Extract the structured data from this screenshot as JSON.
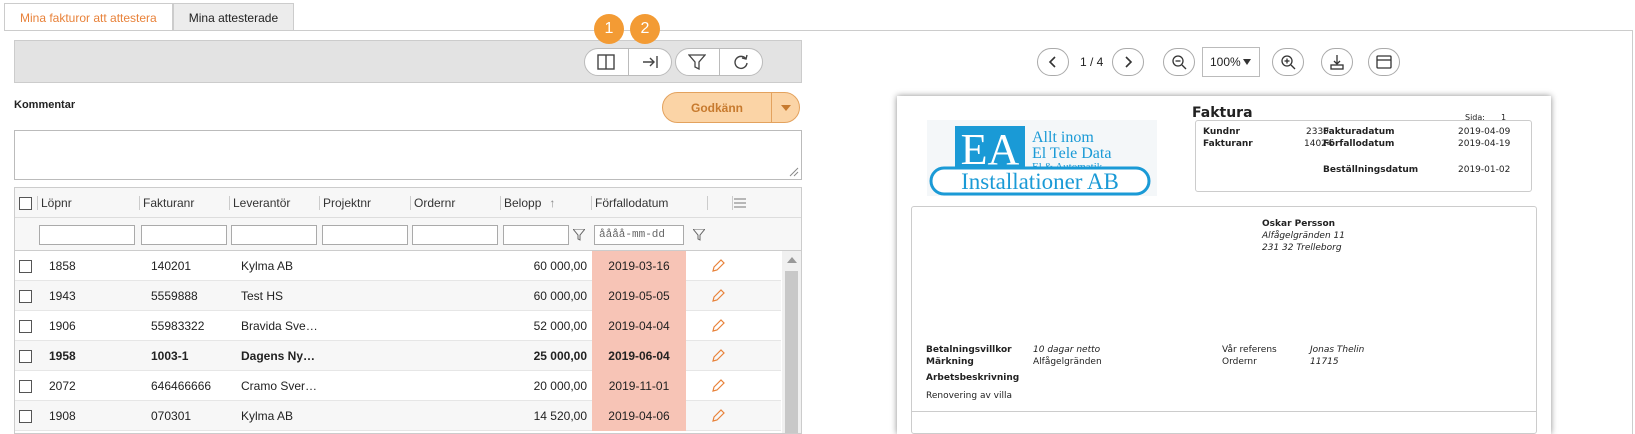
{
  "tabs": [
    {
      "label": "Mina fakturor att attestera"
    },
    {
      "label": "Mina attesterade"
    }
  ],
  "badges": [
    "1",
    "2"
  ],
  "comment_label": "Kommentar",
  "approve_label": "Godkänn",
  "grid": {
    "columns": [
      "Löpnr",
      "Fakturanr",
      "Leverantör",
      "Projektnr",
      "Ordernr",
      "Belopp",
      "Förfallodatum"
    ],
    "date_placeholder": "åååå-mm-dd",
    "sort_arrow": "↑",
    "rows": [
      {
        "lopnr": "1858",
        "fakturanr": "140201",
        "leverantor": "Kylma AB",
        "belopp": "60 000,00",
        "due": "2019-03-16",
        "bold": false
      },
      {
        "lopnr": "1943",
        "fakturanr": "5559888",
        "leverantor": "Test HS",
        "belopp": "60 000,00",
        "due": "2019-05-05",
        "bold": false
      },
      {
        "lopnr": "1906",
        "fakturanr": "55983322",
        "leverantor": "Bravida Sve…",
        "belopp": "52 000,00",
        "due": "2019-04-04",
        "bold": false
      },
      {
        "lopnr": "1958",
        "fakturanr": "1003-1",
        "leverantor": "Dagens Ny…",
        "belopp": "25 000,00",
        "due": "2019-06-04",
        "bold": true
      },
      {
        "lopnr": "2072",
        "fakturanr": "646466666",
        "leverantor": "Cramo Sver…",
        "belopp": "20 000,00",
        "due": "2019-11-01",
        "bold": false
      },
      {
        "lopnr": "1908",
        "fakturanr": "070301",
        "leverantor": "Kylma AB",
        "belopp": "14 520,00",
        "due": "2019-04-06",
        "bold": false
      }
    ]
  },
  "viewer": {
    "page": "1 / 4",
    "zoom": "100%"
  },
  "invoice": {
    "logo": {
      "letters": "EA",
      "line1": "Allt inom",
      "line2": "El Tele Data",
      "line3": "El & Automatik",
      "bottom": "Installationer AB"
    },
    "title": "Faktura",
    "sida_label": "Sida:",
    "sida_value": "1",
    "kundnr_label": "Kundnr",
    "kundnr": "2330",
    "fakturanr_label": "Fakturanr",
    "fakturanr": "14024",
    "fakturadatum_label": "Fakturadatum",
    "fakturadatum": "2019-04-09",
    "forfallodatum_label": "Förfallodatum",
    "forfallodatum": "2019-04-19",
    "bestallningsdatum_label": "Beställningsdatum",
    "bestallningsdatum": "2019-01-02",
    "recipient_name": "Oskar Persson",
    "recipient_street": "Alfågelgränden 11",
    "recipient_city": "231 32 Trelleborg",
    "betalningsvillkor_label": "Betalningsvillkor",
    "betalningsvillkor": "10 dagar netto",
    "markning_label": "Märkning",
    "markning": "Alfågelgränden",
    "var_referens_label": "Vår referens",
    "var_referens": "Jonas Thelin",
    "ordernr_label": "Ordernr",
    "ordernr": "11715",
    "arbetsbeskrivning_label": "Arbetsbeskrivning",
    "arbetsbeskrivning": "Renovering av villa"
  },
  "colors": {
    "accent": "#e8823a",
    "badge": "#f39b34",
    "due_bg": "#f7c4b6",
    "approve_bg": "#fbd4a6",
    "logo_blue": "#1a9ad6"
  }
}
